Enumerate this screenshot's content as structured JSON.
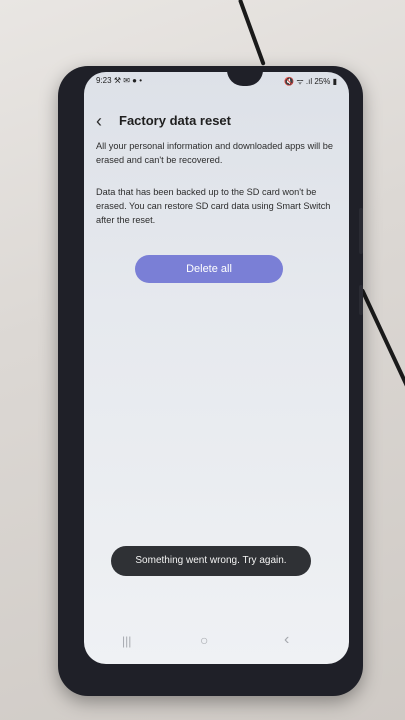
{
  "status_bar": {
    "time": "9:23",
    "left_icons": "⚒ ✉ ● •",
    "right_icons": "🔇 ᯤ .ıl",
    "battery": "25% ▮"
  },
  "header": {
    "title": "Factory data reset"
  },
  "body": {
    "paragraph1": "All your personal information and downloaded apps will be erased and can't be recovered.",
    "paragraph2": "Data that has been backed up to the SD card won't be erased. You can restore SD card data using Smart Switch after the reset."
  },
  "delete_button": {
    "label": "Delete all",
    "color": "#7a7fd6"
  },
  "toast": {
    "message": "Something went wrong. Try again."
  },
  "navbar": {
    "recents": "|||",
    "home": "○",
    "back": "‹"
  }
}
